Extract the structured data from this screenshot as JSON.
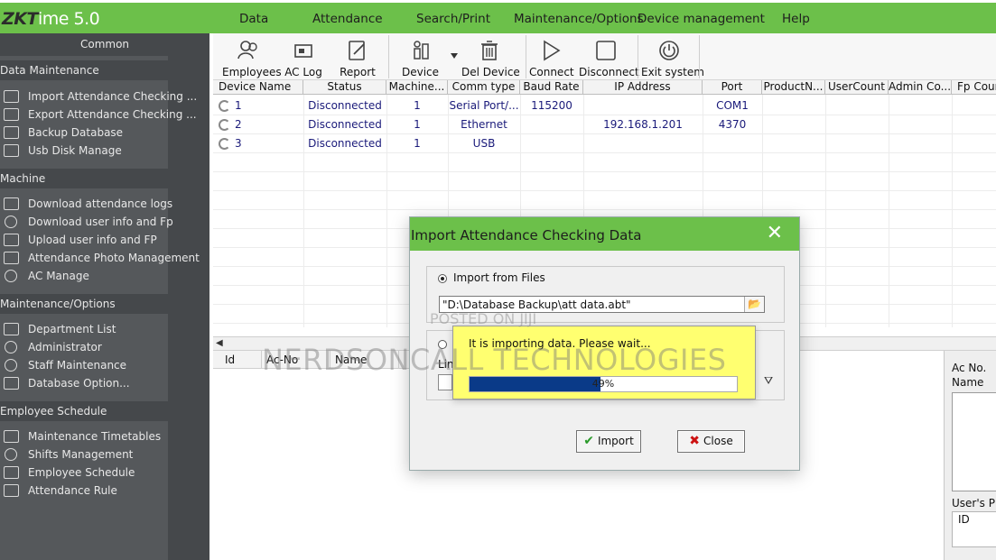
{
  "app": {
    "title_prefix": "ZKT",
    "title_suffix": "ime 5.0"
  },
  "menu": [
    "Data",
    "Attendance",
    "Search/Print",
    "Maintenance/Options",
    "Device management",
    "Help"
  ],
  "sidebar": {
    "common": "Common",
    "sections": [
      {
        "title": "Data Maintenance",
        "items": [
          "Import Attendance Checking ...",
          "Export Attendance Checking ...",
          "Backup Database",
          "Usb Disk Manage"
        ]
      },
      {
        "title": "Machine",
        "items": [
          "Download attendance logs",
          "Download user info and Fp",
          "Upload user info and FP",
          "Attendance Photo Management",
          "AC Manage"
        ]
      },
      {
        "title": "Maintenance/Options",
        "items": [
          "Department List",
          "Administrator",
          "Staff Maintenance",
          "Database Option..."
        ]
      },
      {
        "title": "Employee Schedule",
        "items": [
          "Maintenance Timetables",
          "Shifts Management",
          "Employee Schedule",
          "Attendance Rule"
        ]
      }
    ]
  },
  "toolbar": {
    "employees": "Employees",
    "ac_log": "AC Log",
    "report": "Report",
    "device": "Device",
    "del_device": "Del Device",
    "connect": "Connect",
    "disconnect": "Disconnect",
    "exit_system": "Exit system"
  },
  "grid": {
    "columns": [
      "Device Name",
      "Status",
      "Machine...",
      "Comm type",
      "Baud Rate",
      "IP Address",
      "Port",
      "ProductN...",
      "UserCount",
      "Admin Co...",
      "Fp Count"
    ],
    "rows": [
      {
        "name": "1",
        "status": "Disconnected",
        "machine": "1",
        "comm": "Serial Port/...",
        "baud": "115200",
        "ip": "",
        "port": "COM1"
      },
      {
        "name": "2",
        "status": "Disconnected",
        "machine": "1",
        "comm": "Ethernet",
        "baud": "",
        "ip": "192.168.1.201",
        "port": "4370"
      },
      {
        "name": "3",
        "status": "Disconnected",
        "machine": "1",
        "comm": "USB",
        "baud": "",
        "ip": "",
        "port": ""
      }
    ]
  },
  "lower": {
    "columns": [
      "Id",
      "Ac-No",
      "Name"
    ]
  },
  "right_panel": {
    "ac_no": "Ac No.",
    "name": "Name",
    "users_photo": "User's Pho",
    "id": "ID"
  },
  "dialog": {
    "title": "Import Attendance Checking Data",
    "close": "✕",
    "import_from_files": "Import from Files",
    "file_path": "\"D:\\Database Backup\\att data.abt\"",
    "lin_label": "Lin",
    "import_button": "Import",
    "close_button": "Close"
  },
  "progress": {
    "message": "It is importing data. Please wait...",
    "percent_label": "49%",
    "fraction": 0.49
  },
  "watermarks": {
    "posted": "POSTED ON JIJI",
    "brand": "NERDSONCALL TECHNOLOGIES"
  },
  "colors": {
    "accent_green": "#6cc04a",
    "sidebar": "#55585b",
    "progress_fill": "#0a3a88",
    "popup_yellow": "#ffff70"
  }
}
